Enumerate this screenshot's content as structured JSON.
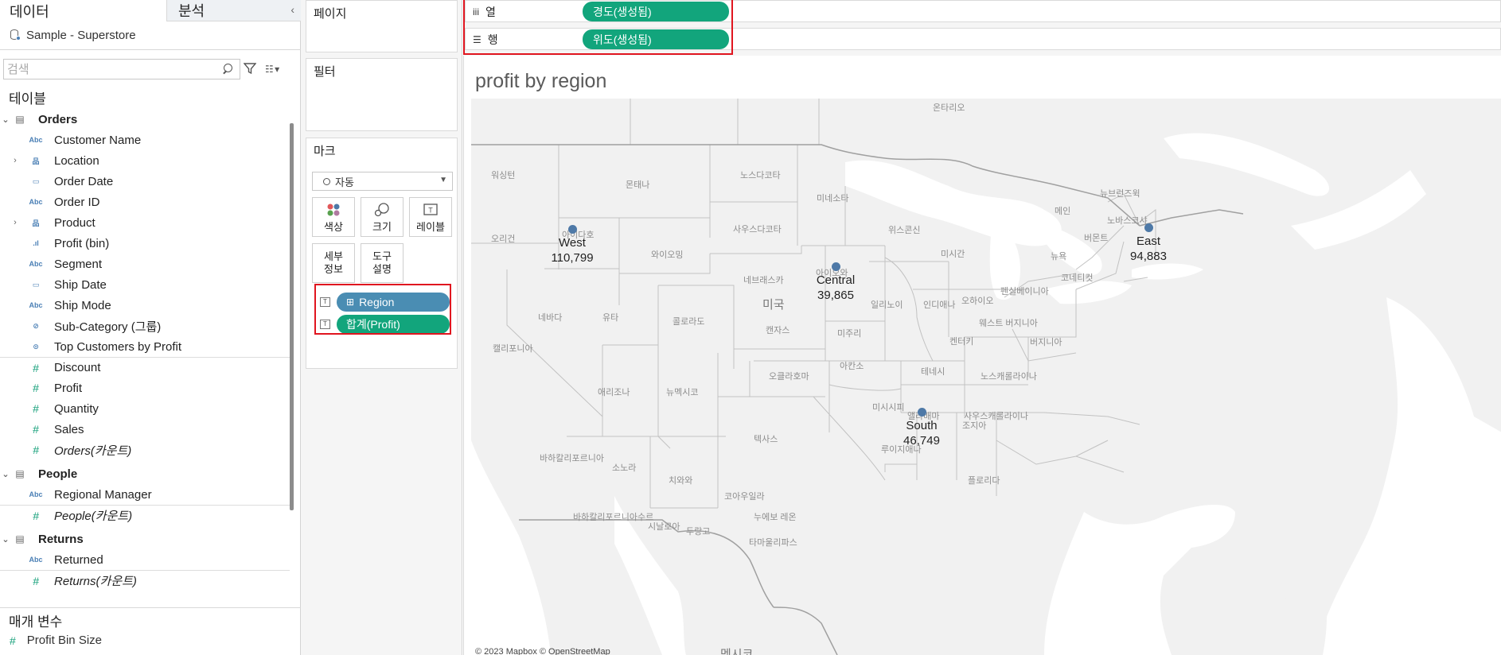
{
  "left_pane": {
    "tabs": {
      "data": "데이터",
      "analysis": "분석",
      "collapse": "‹"
    },
    "datasource": "Sample - Superstore",
    "search_placeholder": "검색",
    "tables_title": "테이블",
    "tree": [
      {
        "type": "table",
        "label": "Orders",
        "expand": "⌄"
      },
      {
        "type": "dim",
        "icon": "Abc",
        "label": "Customer Name"
      },
      {
        "type": "hier",
        "icon": "品",
        "label": "Location",
        "expand": "›"
      },
      {
        "type": "dim",
        "icon": "▭",
        "label": "Order Date"
      },
      {
        "type": "dim",
        "icon": "Abc",
        "label": "Order ID"
      },
      {
        "type": "hier",
        "icon": "品",
        "label": "Product",
        "expand": "›"
      },
      {
        "type": "dim",
        "icon": ".ıl",
        "label": "Profit (bin)"
      },
      {
        "type": "dim",
        "icon": "Abc",
        "label": "Segment"
      },
      {
        "type": "dim",
        "icon": "▭",
        "label": "Ship Date"
      },
      {
        "type": "dim",
        "icon": "Abc",
        "label": "Ship Mode"
      },
      {
        "type": "dim",
        "icon": "⊘",
        "label": "Sub-Category (그룹)"
      },
      {
        "type": "dim",
        "icon": "⊙",
        "label": "Top Customers by Profit"
      },
      {
        "type": "measure",
        "icon": "#",
        "label": "Discount",
        "sep": true
      },
      {
        "type": "measure",
        "icon": "#",
        "label": "Profit"
      },
      {
        "type": "measure",
        "icon": "#",
        "label": "Quantity"
      },
      {
        "type": "measure",
        "icon": "#",
        "label": "Sales"
      },
      {
        "type": "measure",
        "icon": "#",
        "label": "Orders(카운트)",
        "italic": true
      },
      {
        "type": "table",
        "label": "People",
        "expand": "⌄"
      },
      {
        "type": "dim",
        "icon": "Abc",
        "label": "Regional Manager"
      },
      {
        "type": "measure",
        "icon": "#",
        "label": "People(카운트)",
        "italic": true,
        "sep": true
      },
      {
        "type": "table",
        "label": "Returns",
        "expand": "⌄"
      },
      {
        "type": "dim",
        "icon": "Abc",
        "label": "Returned"
      },
      {
        "type": "measure",
        "icon": "#",
        "label": "Returns(카운트)",
        "italic": true,
        "sep": true
      }
    ],
    "params_title": "매개 변수",
    "param_item": "Profit Bin Size"
  },
  "shelves": {
    "pages": "페이지",
    "filters": "필터",
    "marks": "마크",
    "mark_type": "자동",
    "buttons": {
      "color": "색상",
      "size": "크기",
      "label": "레이블",
      "detail_1": "세부",
      "detail_2": "정보",
      "tooltip_1": "도구",
      "tooltip_2": "설명"
    },
    "mark_pills": [
      {
        "label": "Region",
        "color": "blue"
      },
      {
        "label": "합계(Profit)",
        "color": "green"
      }
    ]
  },
  "columns_shelf": {
    "label": "열",
    "pill": "경도(생성됨)"
  },
  "rows_shelf": {
    "label": "행",
    "pill": "위도(생성됨)"
  },
  "viz": {
    "title": "profit by region",
    "attribution": "© 2023 Mapbox © OpenStreetMap",
    "country_label": "미국",
    "mexico_label": "멕시코",
    "places": [
      {
        "t": "온타리오"
      },
      {
        "t": "워싱턴"
      },
      {
        "t": "몬태나"
      },
      {
        "t": "노스다코타"
      },
      {
        "t": "미네소타"
      },
      {
        "t": "오리건"
      },
      {
        "t": "아이다호"
      },
      {
        "t": "와이오밍"
      },
      {
        "t": "사우스다코타"
      },
      {
        "t": "위스콘신"
      },
      {
        "t": "미시간"
      },
      {
        "t": "뉴욕"
      },
      {
        "t": "메인"
      },
      {
        "t": "버몬트"
      },
      {
        "t": "뉴브런즈윅"
      },
      {
        "t": "노바스코샤"
      },
      {
        "t": "네브래스카"
      },
      {
        "t": "아이오와"
      },
      {
        "t": "일리노이"
      },
      {
        "t": "인디애나"
      },
      {
        "t": "오하이오"
      },
      {
        "t": "펜실베이니아"
      },
      {
        "t": "코네티컷"
      },
      {
        "t": "네바다"
      },
      {
        "t": "유타"
      },
      {
        "t": "콜로라도"
      },
      {
        "t": "캔자스"
      },
      {
        "t": "미주리"
      },
      {
        "t": "웨스트 버지니아"
      },
      {
        "t": "버지니아"
      },
      {
        "t": "켄터키"
      },
      {
        "t": "캘리포니아"
      },
      {
        "t": "오클라호마"
      },
      {
        "t": "테네시"
      },
      {
        "t": "노스캐롤라이나"
      },
      {
        "t": "애리조나"
      },
      {
        "t": "뉴멕시코"
      },
      {
        "t": "아칸소"
      },
      {
        "t": "사우스캐롤라이나"
      },
      {
        "t": "미시시피"
      },
      {
        "t": "앨라배마"
      },
      {
        "t": "조지아"
      },
      {
        "t": "텍사스"
      },
      {
        "t": "루이지애나"
      },
      {
        "t": "플로리다"
      },
      {
        "t": "바하칼리포르니아"
      },
      {
        "t": "소노라"
      },
      {
        "t": "치와와"
      },
      {
        "t": "코아우일라"
      },
      {
        "t": "누에보 레온"
      },
      {
        "t": "바하칼리포르니아수르"
      },
      {
        "t": "시날로아"
      },
      {
        "t": "두랑고"
      },
      {
        "t": "타마울리파스"
      }
    ],
    "marks": [
      {
        "region": "West",
        "value": "110,799"
      },
      {
        "region": "Central",
        "value": "39,865"
      },
      {
        "region": "East",
        "value": "94,883"
      },
      {
        "region": "South",
        "value": "46,749"
      }
    ]
  }
}
